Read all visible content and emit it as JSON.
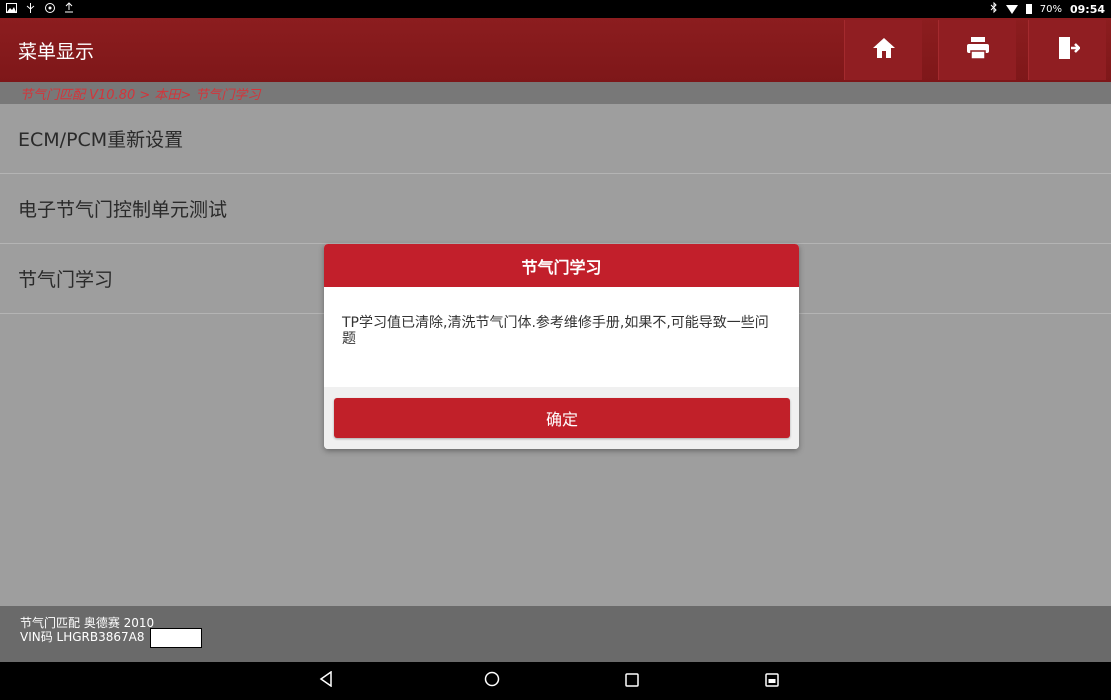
{
  "status_bar": {
    "battery": "70%",
    "time": "09:54"
  },
  "header": {
    "title": "菜单显示"
  },
  "breadcrumb": "节气门匹配 V10.80 > 本田> 节气门学习",
  "menu": {
    "items": [
      {
        "label": "ECM/PCM重新设置"
      },
      {
        "label": "电子节气门控制单元测试"
      },
      {
        "label": "节气门学习"
      }
    ]
  },
  "dialog": {
    "title": "节气门学习",
    "message": "TP学习值已清除,清洗节气门体.参考维修手册,如果不,可能导致一些问题",
    "ok_label": "确定"
  },
  "footer": {
    "line1": "节气门匹配  奥德赛 2010",
    "line2": "VIN码 LHGRB3867A8"
  },
  "colors": {
    "header": "#8c1d1f",
    "dialog_accent": "#c21f2b",
    "breadcrumb_text": "#d4343a"
  }
}
